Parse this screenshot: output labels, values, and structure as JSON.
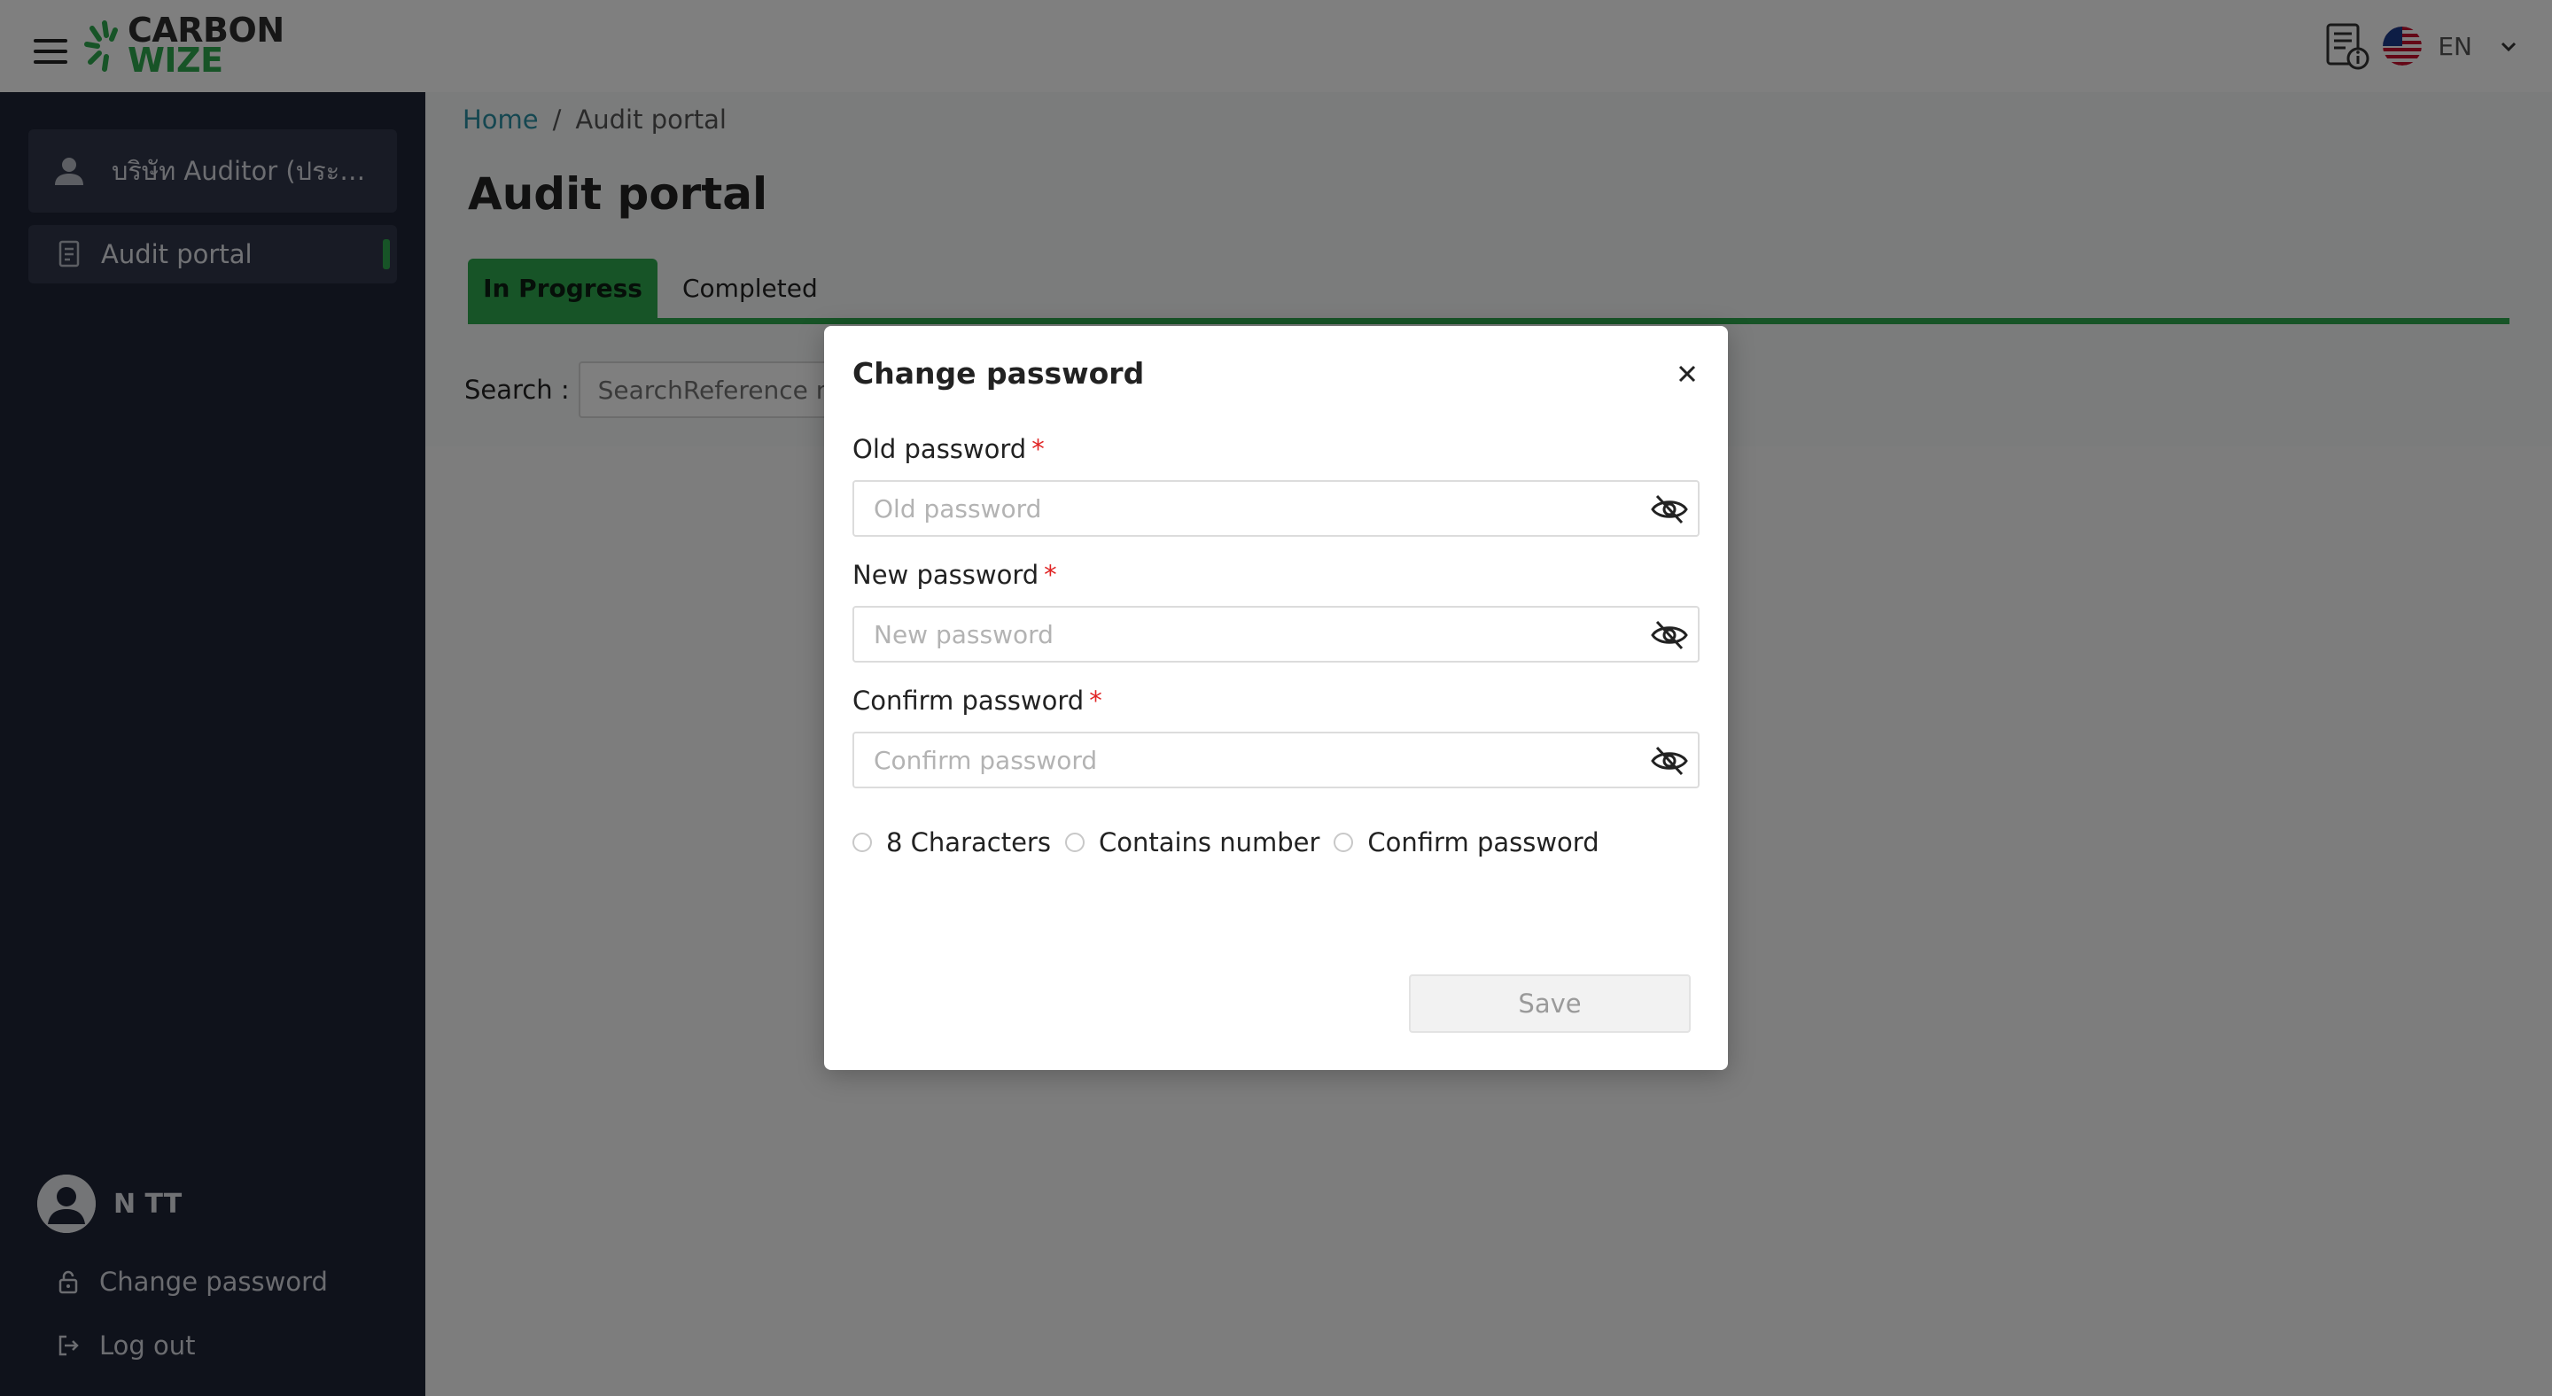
{
  "header": {
    "logo_line1": "CARBON",
    "logo_line2": "WIZE",
    "language": "EN",
    "icons": {
      "menu": "hamburger-menu-icon",
      "manual": "document-info-icon",
      "flag": "us-flag-icon",
      "dropdown": "chevron-down-icon"
    }
  },
  "sidebar": {
    "company_name": "บริษัท Auditor (ประเภท...",
    "nav_items": [
      {
        "label": "Audit portal",
        "active": true
      }
    ],
    "user_name": "N TT",
    "change_password_label": "Change password",
    "logout_label": "Log out"
  },
  "main": {
    "breadcrumb_home": "Home",
    "breadcrumb_separator": "/",
    "breadcrumb_current": "Audit portal",
    "page_title": "Audit portal",
    "tabs": [
      {
        "label": "In Progress",
        "active": true
      },
      {
        "label": "Completed",
        "active": false
      }
    ],
    "search_label": "Search :",
    "search_placeholder": "SearchReference number"
  },
  "modal": {
    "title": "Change password",
    "fields": [
      {
        "label": "Old password",
        "placeholder": "Old password",
        "required_mark": "*"
      },
      {
        "label": "New password",
        "placeholder": "New password",
        "required_mark": "*"
      },
      {
        "label": "Confirm password",
        "placeholder": "Confirm password",
        "required_mark": "*"
      }
    ],
    "rules": [
      "8 Characters",
      "Contains number",
      "Confirm password"
    ],
    "save_label": "Save"
  },
  "colors": {
    "brand_green": "#2fa84f",
    "sidebar_bg": "#1e2436",
    "link": "#2b8fa3",
    "required": "#e02424"
  }
}
